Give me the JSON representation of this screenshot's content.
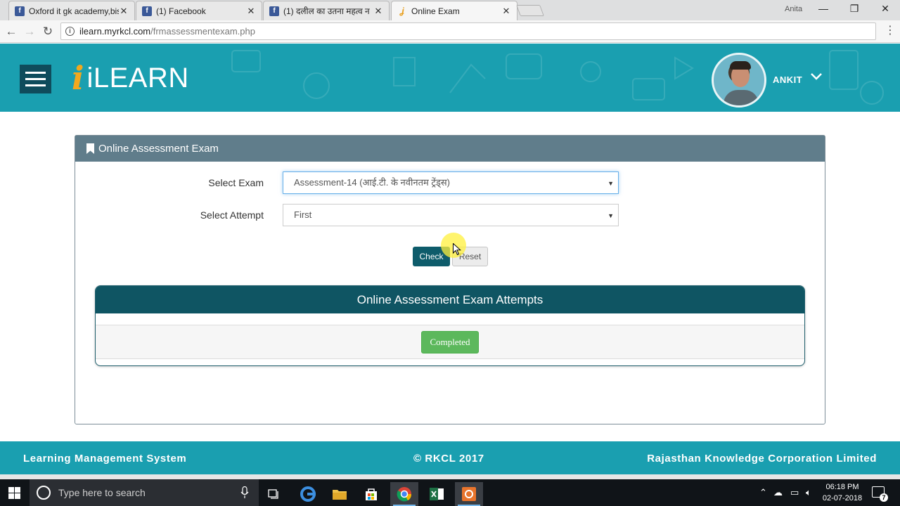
{
  "browser": {
    "tabs": [
      {
        "title": "Oxford it gk academy,bis",
        "favicon": "facebook-icon",
        "active": false
      },
      {
        "title": "(1) Facebook",
        "favicon": "facebook-icon",
        "active": false
      },
      {
        "title": "(1) दलील का उतना महत्व न",
        "favicon": "facebook-icon",
        "active": false
      },
      {
        "title": "Online Exam",
        "favicon": "ilearn-icon",
        "active": true
      }
    ],
    "profile_name": "Anita",
    "url_host": "ilearn.myrkcl.com",
    "url_path": "/frmassessmentexam.php"
  },
  "header": {
    "logo_text": "iLEARN",
    "logo_mark": "i",
    "username": "ANKIT"
  },
  "panel": {
    "title": "Online Assessment Exam",
    "select_exam_label": "Select Exam",
    "select_exam_value": "Assessment-14 (आई.टी. के नवीनतम ट्रेंड्स)",
    "select_attempt_label": "Select Attempt",
    "select_attempt_value": "First",
    "check_label": "Check",
    "reset_label": "Reset",
    "attempts_title": "Online Assessment Exam Attempts",
    "attempt_status": "Completed"
  },
  "footer": {
    "left": "Learning Management System",
    "middle": "© RKCL 2017",
    "right": "Rajasthan Knowledge Corporation Limited"
  },
  "taskbar": {
    "search_placeholder": "Type here to search",
    "time": "06:18 PM",
    "date": "02-07-2018",
    "notification_count": "7"
  },
  "colors": {
    "header_teal": "#1a9fb0",
    "panel_head": "#607d8b",
    "attempts_head": "#0f5563",
    "check_button": "#0e5c6b",
    "completed_green": "#5cb85c",
    "logo_orange": "#f2a81d"
  }
}
